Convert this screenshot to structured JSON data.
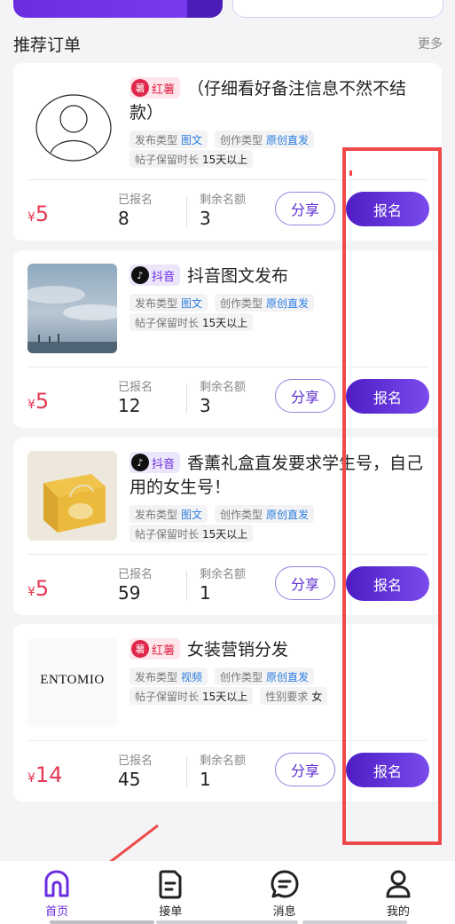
{
  "section": {
    "title": "推荐订单",
    "more": "更多"
  },
  "labels": {
    "publish_type": "发布类型",
    "create_type": "创作类型",
    "retention": "帖子保留时长",
    "gender": "性别要求",
    "signed_up": "已报名",
    "remaining": "剩余名额",
    "currency": "¥",
    "share": "分享",
    "signup": "报名"
  },
  "orders": [
    {
      "platform": "红薯",
      "platform_logo": "薯",
      "platform_icon": "hongshu-icon",
      "title": "（仔细看好备注信息不然不结款）",
      "publish_type": "图文",
      "create_type": "原创直发",
      "retention": "15天以上",
      "price": "5",
      "signed_up": "8",
      "remaining": "3"
    },
    {
      "platform": "抖音",
      "platform_logo": "♪",
      "platform_icon": "douyin-icon",
      "title": "抖音图文发布",
      "publish_type": "图文",
      "create_type": "原创直发",
      "retention": "15天以上",
      "price": "5",
      "signed_up": "12",
      "remaining": "3"
    },
    {
      "platform": "抖音",
      "platform_logo": "♪",
      "platform_icon": "douyin-icon",
      "title": "香薰礼盒直发要求学生号，自己用的女生号！",
      "publish_type": "图文",
      "create_type": "原创直发",
      "retention": "15天以上",
      "price": "5",
      "signed_up": "59",
      "remaining": "1"
    },
    {
      "platform": "红薯",
      "platform_logo": "薯",
      "platform_icon": "hongshu-icon",
      "title": "女装营销分发",
      "publish_type": "视频",
      "create_type": "原创直发",
      "retention": "15天以上",
      "gender": "女",
      "brand_text": "ENTOMIO",
      "price": "14",
      "signed_up": "45",
      "remaining": "1"
    }
  ],
  "nav": [
    {
      "label": "首页",
      "icon": "home-icon",
      "active": true
    },
    {
      "label": "接单",
      "icon": "document-icon",
      "active": false
    },
    {
      "label": "消息",
      "icon": "chat-icon",
      "active": false
    },
    {
      "label": "我的",
      "icon": "user-icon",
      "active": false
    }
  ],
  "colors": {
    "accent": "#6a2de0",
    "price": "#e53955",
    "annotation": "#ef4a4a"
  }
}
